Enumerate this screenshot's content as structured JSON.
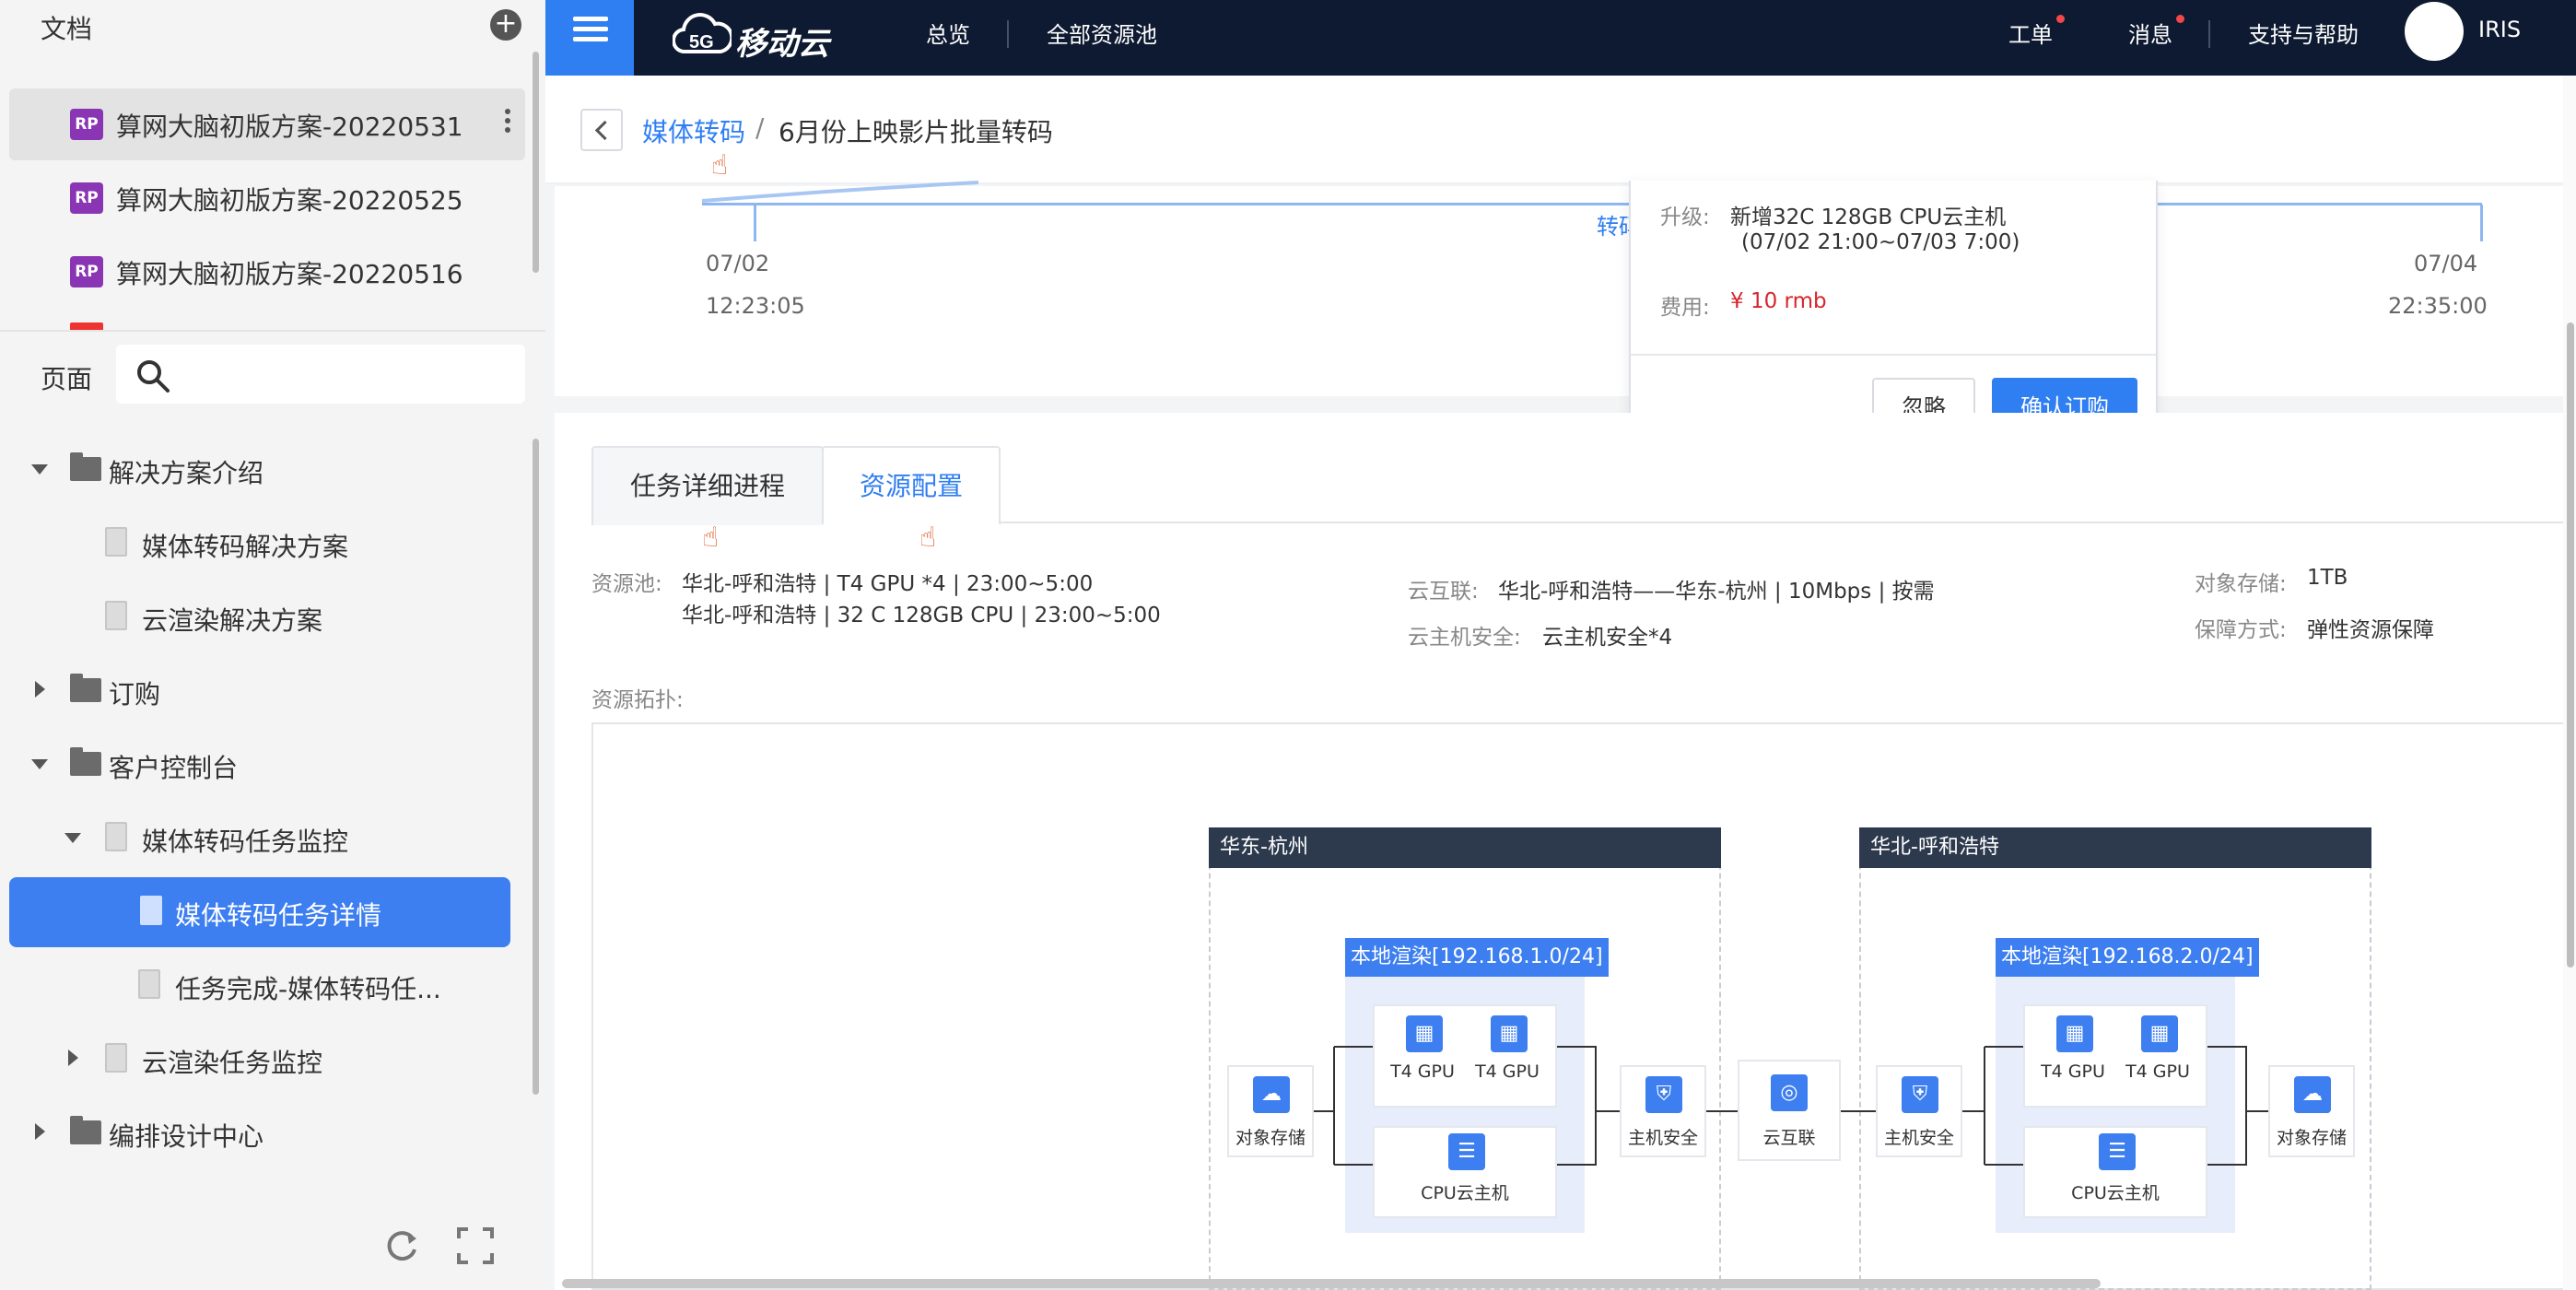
{
  "left_panel": {
    "docs_header": "文档",
    "docs": [
      {
        "badge": "RP",
        "label": "算网大脑初版方案-20220531"
      },
      {
        "badge": "RP",
        "label": "算网大脑初版方案-20220525"
      },
      {
        "badge": "RP",
        "label": "算网大脑初版方案-20220516"
      }
    ],
    "pages_label": "页面",
    "tree": [
      "解决方案介绍",
      "媒体转码解决方案",
      "云渲染解决方案",
      "订购",
      "客户控制台",
      "媒体转码任务监控",
      "媒体转码任务详情",
      "任务完成-媒体转码任...",
      "云渲染任务监控",
      "编排设计中心"
    ]
  },
  "nav": {
    "logo_badge": "5G",
    "logo_text": "移动云",
    "links": [
      "总览",
      "全部资源池"
    ],
    "right": [
      "工单",
      "消息",
      "支持与帮助"
    ],
    "user": "IRIS"
  },
  "breadcrumb": {
    "parent": "媒体转码",
    "separator": "/",
    "current": "6月份上映影片批量转码"
  },
  "timeline": {
    "start_date": "07/02",
    "start_time": "12:23:05",
    "end_date": "07/04",
    "end_time": "22:35:00",
    "marker_label": "转码"
  },
  "popup": {
    "upgrade_label": "升级:",
    "upgrade_value": "新增32C 128GB CPU云主机",
    "upgrade_period": "(07/02 21:00~07/03 7:00)",
    "cost_label": "费用:",
    "cost_value": "¥ 10 rmb",
    "ignore_btn": "忽略",
    "confirm_btn": "确认订购"
  },
  "tabs": [
    "任务详细进程",
    "资源配置"
  ],
  "resource": {
    "pool_label": "资源池:",
    "pool_line1": "华北-呼和浩特 | T4 GPU *4 | 23:00~5:00",
    "pool_line2": "华北-呼和浩特 | 32 C 128GB CPU | 23:00~5:00",
    "interconnect_label": "云互联:",
    "interconnect_value": "华北-呼和浩特——华东-杭州 | 10Mbps | 按需",
    "host_security_label": "云主机安全:",
    "host_security_value": "云主机安全*4",
    "storage_label": "对象存储:",
    "storage_value": "1TB",
    "guarantee_label": "保障方式:",
    "guarantee_value": "弹性资源保障",
    "topology_label": "资源拓扑:"
  },
  "topology": {
    "region_east": "华东-杭州",
    "region_north": "华北-呼和浩特",
    "subnet_east": "本地渲染[192.168.1.0/24]",
    "subnet_north": "本地渲染[192.168.2.0/24]",
    "gpu": "T4 GPU",
    "cpu_host": "CPU云主机",
    "object_storage": "对象存储",
    "host_security": "主机安全",
    "cloud_link": "云互联"
  }
}
